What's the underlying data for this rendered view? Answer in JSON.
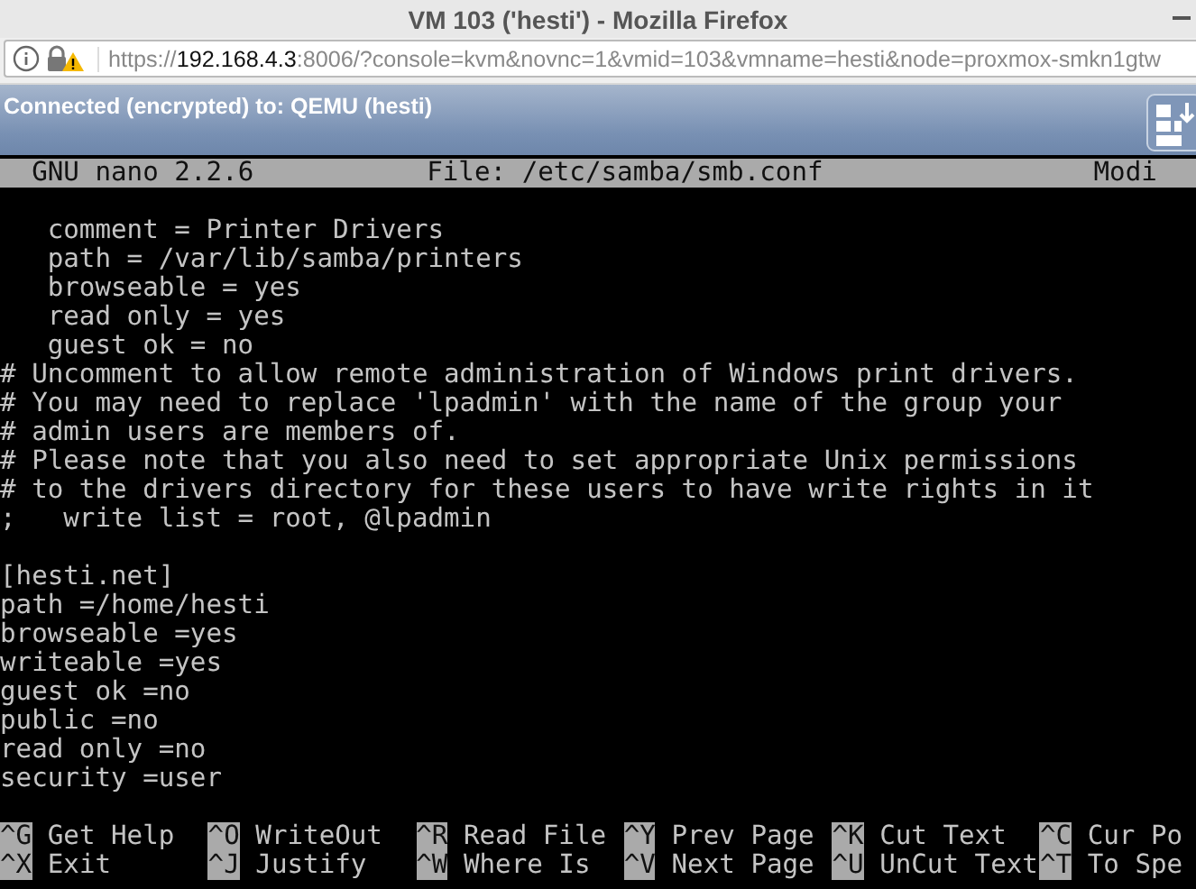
{
  "window": {
    "title": "VM 103 ('hesti') - Mozilla Firefox"
  },
  "url_bar": {
    "scheme": "https://",
    "host": "192.168.4.3",
    "rest": ":8006/?console=kvm&novnc=1&vmid=103&vmname=hesti&node=proxmox-smkn1gtw"
  },
  "vnc_bar": {
    "status": "Connected (encrypted) to: QEMU (hesti)"
  },
  "nano": {
    "version": "GNU nano 2.2.6",
    "file": "File: /etc/samba/smb.conf",
    "state": "Modi",
    "blocks": [
      [
        "   comment = Printer Drivers",
        "   path = /var/lib/samba/printers",
        "   browseable = yes",
        "   read only = yes",
        "   guest ok = no",
        "# Uncomment to allow remote administration of Windows print drivers.",
        "# You may need to replace 'lpadmin' with the name of the group your",
        "# admin users are members of.",
        "# Please note that you also need to set appropriate Unix permissions",
        "# to the drivers directory for these users to have write rights in it",
        ";   write list = root, @lpadmin"
      ],
      [
        "[hesti.net]",
        "path =/home/hesti",
        "browseable =yes",
        "writeable =yes",
        "guest ok =no",
        "public =no",
        "read only =no",
        "security =user"
      ]
    ],
    "shortcuts": [
      {
        "key": "^G",
        "label": "Get Help"
      },
      {
        "key": "^O",
        "label": "WriteOut"
      },
      {
        "key": "^R",
        "label": "Read File"
      },
      {
        "key": "^Y",
        "label": "Prev Page"
      },
      {
        "key": "^K",
        "label": "Cut Text"
      },
      {
        "key": "^C",
        "label": "Cur Po"
      },
      {
        "key": "^X",
        "label": "Exit"
      },
      {
        "key": "^J",
        "label": "Justify"
      },
      {
        "key": "^W",
        "label": "Where Is"
      },
      {
        "key": "^V",
        "label": "Next Page"
      },
      {
        "key": "^U",
        "label": "UnCut Text"
      },
      {
        "key": "^T",
        "label": "To Spe"
      }
    ]
  }
}
